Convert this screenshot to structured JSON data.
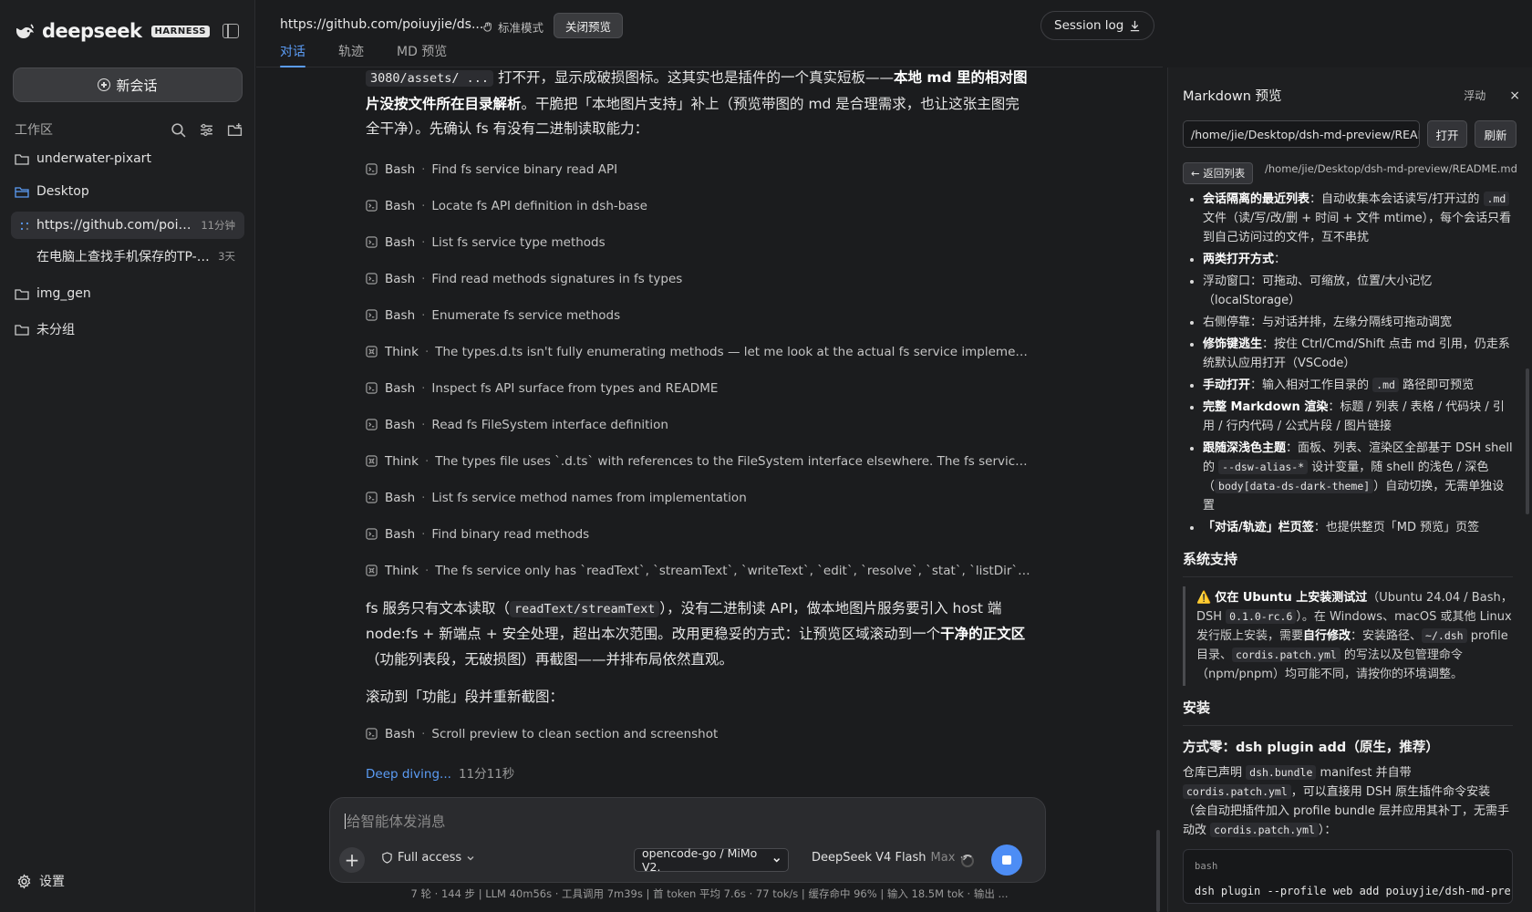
{
  "sidebar": {
    "brand": "deepseek",
    "badge": "HARNESS",
    "new_chat": "新会话",
    "workspace_label": "工作区",
    "folders": [
      "underwater-pixart",
      "Desktop",
      "img_gen",
      "未分组"
    ],
    "sessions": [
      {
        "title": "https://github.com/poiuyji...",
        "time": "11分钟"
      },
      {
        "title": "在电脑上查找手机保存的TP-Li...",
        "time": "3天"
      }
    ],
    "settings": "设置"
  },
  "topbar": {
    "url": "https://github.com/poiuyjie/ds...",
    "mode": "标准模式",
    "close_preview": "关闭预览",
    "session_log": "Session log",
    "tabs": [
      "对话",
      "轨迹",
      "MD 预览"
    ]
  },
  "chat": {
    "intro": {
      "code": "3080/assets/ ...",
      "t1": " 打不开，显示成破损图标。这其实也是插件的一个真实短板——",
      "b1": "本地 md 里的相对图片没按文件所在目录解析",
      "t2": "。干脆把「本地图片支持」补上（预览带图的 md 是合理需求，也让这张主图完全干净）。先确认 fs 有没有二进制读取能力："
    },
    "tools": [
      {
        "kind": "Bash",
        "desc": "Find fs service binary read API"
      },
      {
        "kind": "Bash",
        "desc": "Locate fs API definition in dsh-base"
      },
      {
        "kind": "Bash",
        "desc": "List fs service type methods"
      },
      {
        "kind": "Bash",
        "desc": "Find read methods signatures in fs types"
      },
      {
        "kind": "Bash",
        "desc": "Enumerate fs service methods"
      },
      {
        "kind": "Think",
        "desc": "The types.d.ts isn't fully enumerating methods — let me look at the actual fs service implementation or the ..."
      },
      {
        "kind": "Bash",
        "desc": "Inspect fs API surface from types and README"
      },
      {
        "kind": "Bash",
        "desc": "Read fs FileSystem interface definition"
      },
      {
        "kind": "Think",
        "desc": "The types file uses `.d.ts` with references to the FileSystem interface elsewhere. The fs service has `readText`, ..."
      },
      {
        "kind": "Bash",
        "desc": "List fs service method names from implementation"
      },
      {
        "kind": "Bash",
        "desc": "Find binary read methods"
      },
      {
        "kind": "Think",
        "desc": "The fs service only has `readText`, `streamText`, `writeText`, `edit`, `resolve`, `stat`, `listDir`, `processPath` — **n..."
      }
    ],
    "reply": {
      "t1": "fs 服务只有文本读取（",
      "code": "readText/streamText",
      "t2": "），没有二进制读 API，做本地图片服务要引入 host 端 node:fs + 新端点 + 安全处理，超出本次范围。改用更稳妥的方式：让预览区域滚动到一个",
      "b1": "干净的正文区",
      "t3": "（功能列表段，无破损图）再截图——并排布局依然直观。"
    },
    "scroll_note": "滚动到「功能」段并重新截图：",
    "last_tool": {
      "kind": "Bash",
      "desc": "Scroll preview to clean section and screenshot"
    },
    "status": "Deep diving...",
    "elapsed": "11分11秒"
  },
  "composer": {
    "placeholder": "给智能体发消息",
    "access": "Full access",
    "model": "opencode-go / MiMo V2.",
    "engine": "DeepSeek V4 Flash",
    "engine_level": "Max"
  },
  "statusline": "7 轮 · 144 步  |  LLM 40m56s · 工具调用 7m39s  |  首 token 平均 7.6s · 77 tok/s  |  缓存命中 96%  |  输入 18.5M tok · 输出 ...",
  "preview": {
    "title": "Markdown 预览",
    "float": "浮动",
    "close": "×",
    "path": "/home/jie/Desktop/dsh-md-preview/README",
    "open": "打开",
    "refresh": "刷新",
    "back": "← 返回列表",
    "crumb": "/home/jie/Desktop/dsh-md-preview/README.md",
    "features": [
      {
        "b": "会话隔离的最近列表",
        "t": "：自动收集本会话读写/打开过的 ",
        "c": ".md",
        "t2": " 文件（读/写/改/删 + 时间 + 文件 mtime），每个会话只看到自己访问过的文件，互不串扰"
      },
      {
        "b": "两类打开方式",
        "t": "："
      },
      {
        "b": "",
        "t": "浮动窗口：可拖动、可缩放，位置/大小记忆（localStorage）"
      },
      {
        "b": "",
        "t": "右侧停靠：与对话并排，左缘分隔线可拖动调宽"
      },
      {
        "b": "修饰键逃生",
        "t": "：按住 Ctrl/Cmd/Shift 点击 md 引用，仍走系统默认应用打开（VSCode）"
      },
      {
        "b": "手动打开",
        "t": "：输入相对工作目录的 ",
        "c": ".md",
        "t2": " 路径即可预览"
      },
      {
        "b": "完整 Markdown 渲染",
        "t": "：标题 / 列表 / 表格 / 代码块 / 引用 / 行内代码 / 公式片段 / 图片链接"
      },
      {
        "b": "跟随深浅色主题",
        "t": "：面板、列表、渲染区全部基于 DSH shell 的 ",
        "c": "--dsw-alias-*",
        "t2": " 设计变量，随 shell 的浅色 / 深色（",
        "c2": "body[data-ds-dark-theme]",
        "t3": "）自动切换，无需单独设置"
      },
      {
        "b": "「对话/轨迹」栏页签",
        "t": "：也提供整页「MD 预览」页签"
      }
    ],
    "h_system": "系统支持",
    "warn": {
      "icon": "⚠️",
      "b": "仅在 Ubuntu 上安装测试过",
      "t1": "（Ubuntu 24.04 / Bash，DSH ",
      "c1": "0.1.0-rc.6",
      "t2": "）。在 Windows、macOS 或其他 Linux 发行版上安装，需要",
      "b2": "自行修改",
      "t3": "：安装路径、",
      "c2": "~/.dsh",
      "t4": " profile 目录、",
      "c3": "cordis.patch.yml",
      "t5": " 的写法以及包管理命令（npm/pnpm）均可能不同，请按你的环境调整。"
    },
    "h_install": "安装",
    "h_method": "方式零：dsh plugin add（原生，推荐）",
    "install": {
      "t1": "仓库已声明 ",
      "c1": "dsh.bundle",
      "t2": " manifest 并自带 ",
      "c2": "cordis.patch.yml",
      "t3": "，可以直接用 DSH 原生插件命令安装（会自动把插件加入 profile bundle 层并应用其补丁，无需手动改 ",
      "c3": "cordis.patch.yml",
      "t4": "）："
    },
    "code_lang": "bash",
    "code_cmd": "dsh plugin --profile web add poiuyjie/dsh-md-pre"
  },
  "colors": {
    "accent": "#5b9cf5",
    "stop_button": "#4d8df5",
    "background": "#1b1c1e"
  }
}
